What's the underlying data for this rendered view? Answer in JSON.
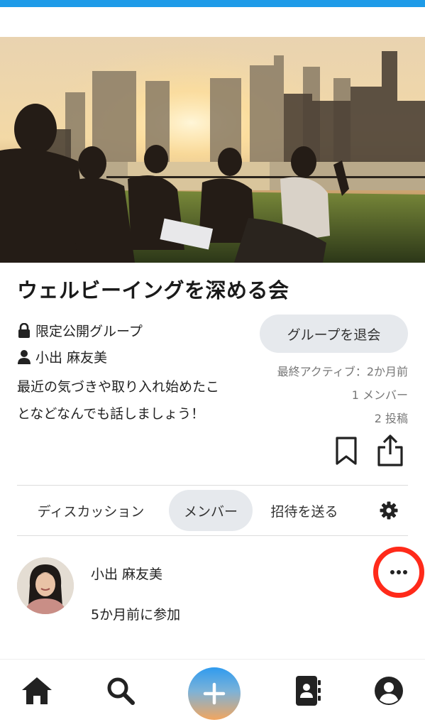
{
  "group": {
    "title": "ウェルビーイングを深める会",
    "privacy": "限定公開グループ",
    "owner": "小出 麻友美",
    "description_line1": "最近の気づきや取り入れ始めたこ",
    "description_line2": "となどなんでも話しましょう！",
    "leave_label": "グループを退会",
    "last_active": "最終アクティブ：2か月前",
    "members_count": "1 メンバー",
    "posts_count": "2 投稿"
  },
  "tabs": {
    "discussion": "ディスカッション",
    "members": "メンバー",
    "invite": "招待を送る",
    "selected": "members"
  },
  "member": {
    "name": "小出 麻友美",
    "joined": "5か月前に参加"
  },
  "icons": {
    "privacy": "lock-icon",
    "owner": "person-icon",
    "bookmark": "bookmark-icon",
    "share": "share-icon",
    "settings": "gear-icon",
    "more": "more-icon",
    "nav": [
      "home-icon",
      "search-icon",
      "plus-icon",
      "directory-icon",
      "profile-icon"
    ]
  },
  "colors": {
    "top_bar": "#1e9be8",
    "highlight_ring": "#ff2a1a",
    "tab_selected_bg": "#e6e9ed",
    "button_bg": "#e6e9ed"
  }
}
